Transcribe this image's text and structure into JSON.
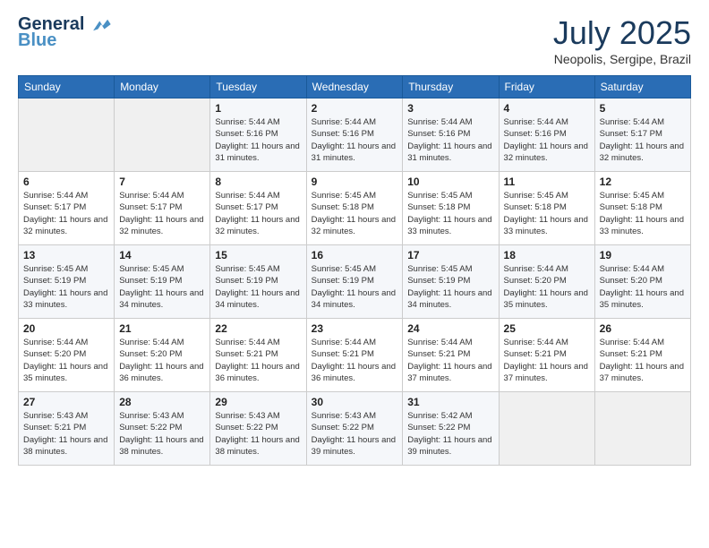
{
  "logo": {
    "line1": "General",
    "line2": "Blue"
  },
  "title": "July 2025",
  "location": "Neopolis, Sergipe, Brazil",
  "days_of_week": [
    "Sunday",
    "Monday",
    "Tuesday",
    "Wednesday",
    "Thursday",
    "Friday",
    "Saturday"
  ],
  "weeks": [
    [
      {
        "day": "",
        "info": ""
      },
      {
        "day": "",
        "info": ""
      },
      {
        "day": "1",
        "info": "Sunrise: 5:44 AM\nSunset: 5:16 PM\nDaylight: 11 hours and 31 minutes."
      },
      {
        "day": "2",
        "info": "Sunrise: 5:44 AM\nSunset: 5:16 PM\nDaylight: 11 hours and 31 minutes."
      },
      {
        "day": "3",
        "info": "Sunrise: 5:44 AM\nSunset: 5:16 PM\nDaylight: 11 hours and 31 minutes."
      },
      {
        "day": "4",
        "info": "Sunrise: 5:44 AM\nSunset: 5:16 PM\nDaylight: 11 hours and 32 minutes."
      },
      {
        "day": "5",
        "info": "Sunrise: 5:44 AM\nSunset: 5:17 PM\nDaylight: 11 hours and 32 minutes."
      }
    ],
    [
      {
        "day": "6",
        "info": "Sunrise: 5:44 AM\nSunset: 5:17 PM\nDaylight: 11 hours and 32 minutes."
      },
      {
        "day": "7",
        "info": "Sunrise: 5:44 AM\nSunset: 5:17 PM\nDaylight: 11 hours and 32 minutes."
      },
      {
        "day": "8",
        "info": "Sunrise: 5:44 AM\nSunset: 5:17 PM\nDaylight: 11 hours and 32 minutes."
      },
      {
        "day": "9",
        "info": "Sunrise: 5:45 AM\nSunset: 5:18 PM\nDaylight: 11 hours and 32 minutes."
      },
      {
        "day": "10",
        "info": "Sunrise: 5:45 AM\nSunset: 5:18 PM\nDaylight: 11 hours and 33 minutes."
      },
      {
        "day": "11",
        "info": "Sunrise: 5:45 AM\nSunset: 5:18 PM\nDaylight: 11 hours and 33 minutes."
      },
      {
        "day": "12",
        "info": "Sunrise: 5:45 AM\nSunset: 5:18 PM\nDaylight: 11 hours and 33 minutes."
      }
    ],
    [
      {
        "day": "13",
        "info": "Sunrise: 5:45 AM\nSunset: 5:19 PM\nDaylight: 11 hours and 33 minutes."
      },
      {
        "day": "14",
        "info": "Sunrise: 5:45 AM\nSunset: 5:19 PM\nDaylight: 11 hours and 34 minutes."
      },
      {
        "day": "15",
        "info": "Sunrise: 5:45 AM\nSunset: 5:19 PM\nDaylight: 11 hours and 34 minutes."
      },
      {
        "day": "16",
        "info": "Sunrise: 5:45 AM\nSunset: 5:19 PM\nDaylight: 11 hours and 34 minutes."
      },
      {
        "day": "17",
        "info": "Sunrise: 5:45 AM\nSunset: 5:19 PM\nDaylight: 11 hours and 34 minutes."
      },
      {
        "day": "18",
        "info": "Sunrise: 5:44 AM\nSunset: 5:20 PM\nDaylight: 11 hours and 35 minutes."
      },
      {
        "day": "19",
        "info": "Sunrise: 5:44 AM\nSunset: 5:20 PM\nDaylight: 11 hours and 35 minutes."
      }
    ],
    [
      {
        "day": "20",
        "info": "Sunrise: 5:44 AM\nSunset: 5:20 PM\nDaylight: 11 hours and 35 minutes."
      },
      {
        "day": "21",
        "info": "Sunrise: 5:44 AM\nSunset: 5:20 PM\nDaylight: 11 hours and 36 minutes."
      },
      {
        "day": "22",
        "info": "Sunrise: 5:44 AM\nSunset: 5:21 PM\nDaylight: 11 hours and 36 minutes."
      },
      {
        "day": "23",
        "info": "Sunrise: 5:44 AM\nSunset: 5:21 PM\nDaylight: 11 hours and 36 minutes."
      },
      {
        "day": "24",
        "info": "Sunrise: 5:44 AM\nSunset: 5:21 PM\nDaylight: 11 hours and 37 minutes."
      },
      {
        "day": "25",
        "info": "Sunrise: 5:44 AM\nSunset: 5:21 PM\nDaylight: 11 hours and 37 minutes."
      },
      {
        "day": "26",
        "info": "Sunrise: 5:44 AM\nSunset: 5:21 PM\nDaylight: 11 hours and 37 minutes."
      }
    ],
    [
      {
        "day": "27",
        "info": "Sunrise: 5:43 AM\nSunset: 5:21 PM\nDaylight: 11 hours and 38 minutes."
      },
      {
        "day": "28",
        "info": "Sunrise: 5:43 AM\nSunset: 5:22 PM\nDaylight: 11 hours and 38 minutes."
      },
      {
        "day": "29",
        "info": "Sunrise: 5:43 AM\nSunset: 5:22 PM\nDaylight: 11 hours and 38 minutes."
      },
      {
        "day": "30",
        "info": "Sunrise: 5:43 AM\nSunset: 5:22 PM\nDaylight: 11 hours and 39 minutes."
      },
      {
        "day": "31",
        "info": "Sunrise: 5:42 AM\nSunset: 5:22 PM\nDaylight: 11 hours and 39 minutes."
      },
      {
        "day": "",
        "info": ""
      },
      {
        "day": "",
        "info": ""
      }
    ]
  ]
}
